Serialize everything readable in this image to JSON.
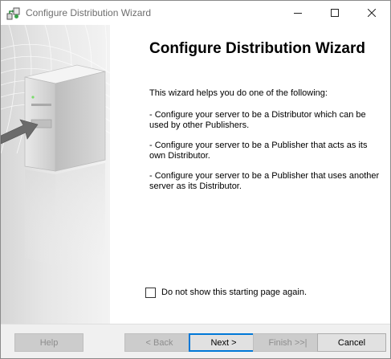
{
  "window": {
    "title": "Configure Distribution Wizard",
    "controls": {
      "minimize": "minimize-icon",
      "maximize": "maximize-icon",
      "close": "close-icon"
    }
  },
  "content": {
    "heading": "Configure Distribution Wizard",
    "intro": "This wizard helps you do one of the following:",
    "bullets": [
      "- Configure your server to be a Distributor which can be used by other Publishers.",
      "- Configure your server to be a Publisher that acts as its own Distributor.",
      "- Configure your server to be a Publisher that uses another server as its Distributor."
    ],
    "checkbox": {
      "label": "Do not show this starting page again.",
      "checked": false
    }
  },
  "buttons": {
    "help": "Help",
    "back": "< Back",
    "next": "Next >",
    "finish": "Finish >>|",
    "cancel": "Cancel"
  },
  "colors": {
    "accent": "#0078d7",
    "footer_bg": "#f0f0f0",
    "disabled_text": "#8d8d8d"
  }
}
